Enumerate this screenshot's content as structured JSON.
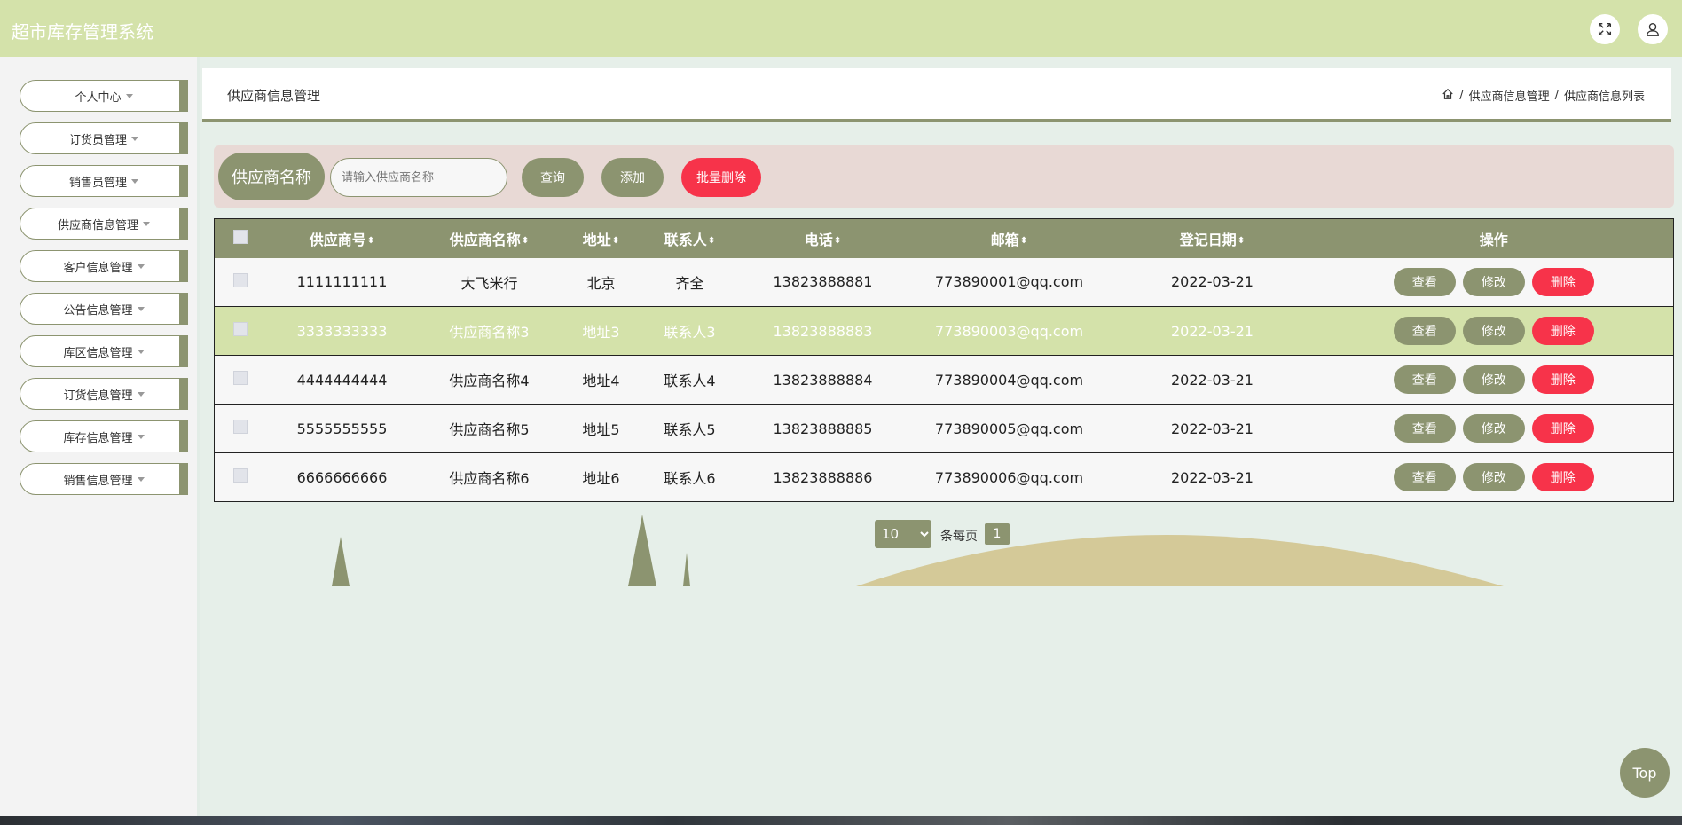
{
  "header": {
    "app_title": "超市库存管理系统",
    "fullscreen_icon": "fullscreen-icon",
    "user_icon": "user-icon"
  },
  "sidebar": {
    "items": [
      {
        "label": "个人中心"
      },
      {
        "label": "订货员管理"
      },
      {
        "label": "销售员管理"
      },
      {
        "label": "供应商信息管理"
      },
      {
        "label": "客户信息管理"
      },
      {
        "label": "公告信息管理"
      },
      {
        "label": "库区信息管理"
      },
      {
        "label": "订货信息管理"
      },
      {
        "label": "库存信息管理"
      },
      {
        "label": "销售信息管理"
      }
    ]
  },
  "page": {
    "title": "供应商信息管理",
    "breadcrumb": [
      "供应商信息管理",
      "供应商信息列表"
    ],
    "breadcrumb_sep": "/"
  },
  "search": {
    "label": "供应商名称",
    "placeholder": "请输入供应商名称",
    "query_label": "查询",
    "add_label": "添加",
    "batch_delete_label": "批量删除"
  },
  "table": {
    "columns": [
      "供应商号",
      "供应商名称",
      "地址",
      "联系人",
      "电话",
      "邮箱",
      "登记日期",
      "操作"
    ],
    "rows": [
      {
        "id": "1111111111",
        "name": "大飞米行",
        "address": "北京",
        "contact": "齐全",
        "phone": "13823888881",
        "email": "773890001@qq.com",
        "date": "2022-03-21"
      },
      {
        "id": "3333333333",
        "name": "供应商名称3",
        "address": "地址3",
        "contact": "联系人3",
        "phone": "13823888883",
        "email": "773890003@qq.com",
        "date": "2022-03-21"
      },
      {
        "id": "4444444444",
        "name": "供应商名称4",
        "address": "地址4",
        "contact": "联系人4",
        "phone": "13823888884",
        "email": "773890004@qq.com",
        "date": "2022-03-21"
      },
      {
        "id": "5555555555",
        "name": "供应商名称5",
        "address": "地址5",
        "contact": "联系人5",
        "phone": "13823888885",
        "email": "773890005@qq.com",
        "date": "2022-03-21"
      },
      {
        "id": "6666666666",
        "name": "供应商名称6",
        "address": "地址6",
        "contact": "联系人6",
        "phone": "13823888886",
        "email": "773890006@qq.com",
        "date": "2022-03-21"
      }
    ],
    "view_label": "查看",
    "edit_label": "修改",
    "delete_label": "删除"
  },
  "pagination": {
    "page_size": "10",
    "per_page_text": "条每页",
    "current_page": "1"
  },
  "back_to_top": "Top",
  "colors": {
    "accent": "#8c9470",
    "header_bg": "#d4e2aa",
    "danger": "#f7334a",
    "search_panel": "#e8d9d5"
  }
}
